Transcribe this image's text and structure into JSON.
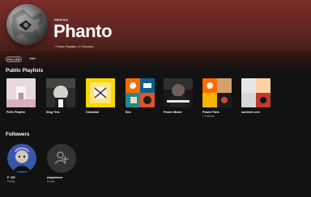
{
  "profile": {
    "label": "PROFILE",
    "name": "Phanto",
    "stats": "7 Public Playlists • 2 Followers"
  },
  "actions": {
    "follow_label": "FOLLOW",
    "more_label": "•••"
  },
  "sections": {
    "playlists_title": "Public Playlists",
    "followers_title": "Followers"
  },
  "playlists": [
    {
      "name": "Feith Playlist",
      "sub": ""
    },
    {
      "name": "Sing This",
      "sub": ""
    },
    {
      "name": "Classical",
      "sub": ""
    },
    {
      "name": "Bes",
      "sub": ""
    },
    {
      "name": "Power Music",
      "sub": ""
    },
    {
      "name": "Power Fans",
      "sub": "1 Follower"
    },
    {
      "name": "sunbed Love",
      "sub": ""
    }
  ],
  "followers": [
    {
      "name": "F_SD",
      "sub": "Profile"
    },
    {
      "name": "mayamour",
      "sub": "Profile"
    }
  ],
  "colors": {
    "header_top": "#7a2e2a",
    "background": "#121212",
    "muted_text": "#a7a7a7"
  }
}
